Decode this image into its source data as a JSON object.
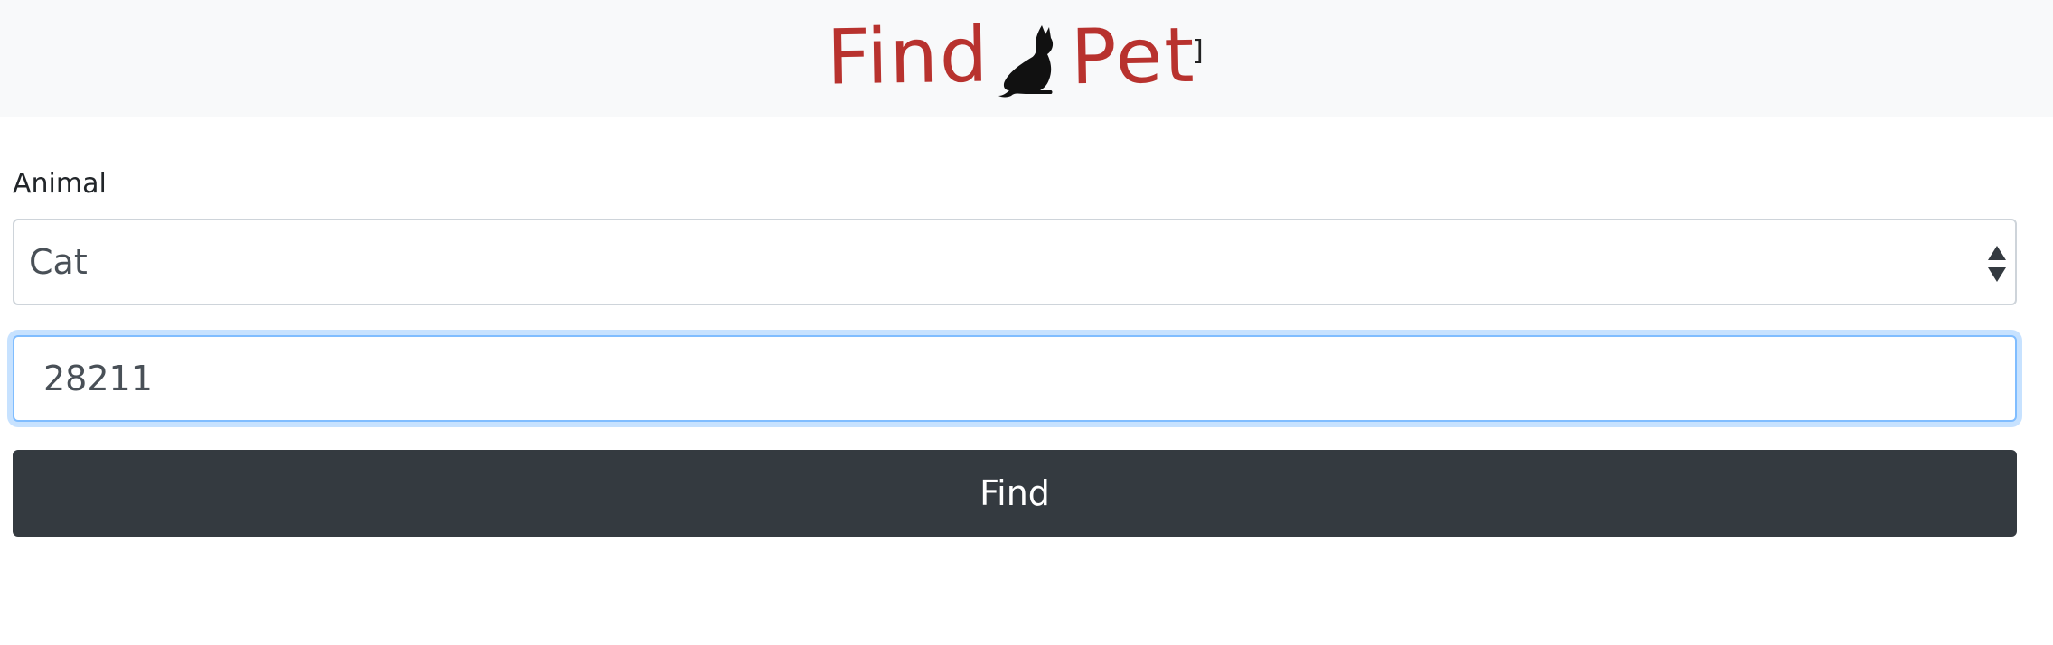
{
  "header": {
    "logo_word_1": "Find",
    "logo_word_2": "Pet",
    "logo_icon": "cat-silhouette-icon",
    "logo_color": "#b8322e",
    "stray_text": "]"
  },
  "form": {
    "animal_label": "Animal",
    "animal_select": {
      "selected": "Cat"
    },
    "zip_input": {
      "value": "28211",
      "focused": true
    },
    "submit_label": "Find"
  },
  "colors": {
    "navbar_bg": "#f8f9fa",
    "button_bg": "#343a40",
    "focus_border": "#80bdff"
  }
}
